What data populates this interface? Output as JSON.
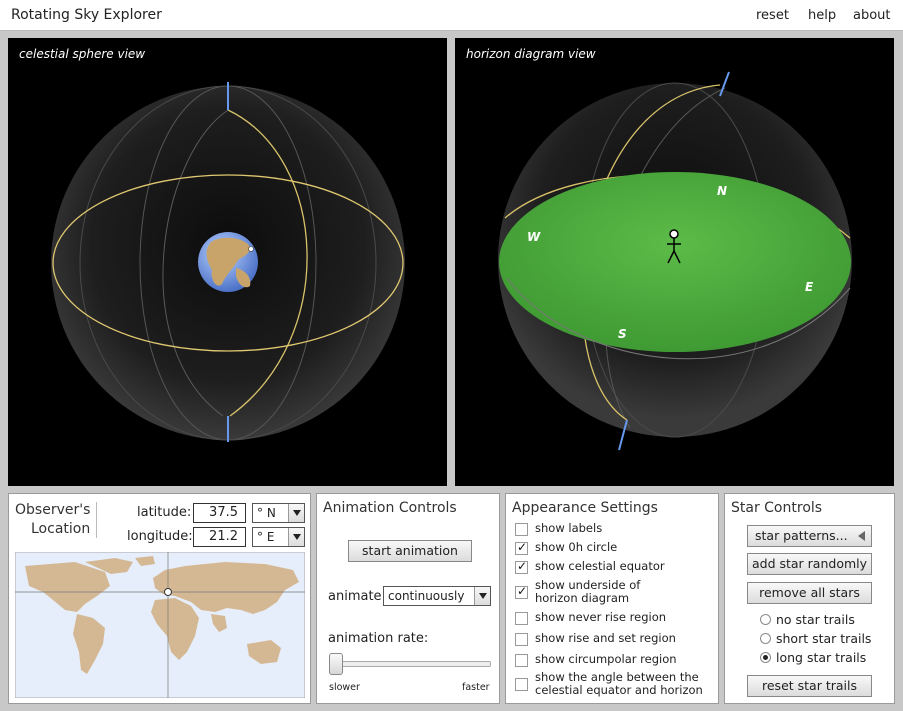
{
  "app": {
    "title": "Rotating Sky Explorer",
    "menu": {
      "reset": "reset",
      "help": "help",
      "about": "about"
    }
  },
  "views": {
    "celestial": {
      "label": "celestial sphere view"
    },
    "horizon": {
      "label": "horizon diagram view",
      "directions": {
        "north": "N",
        "east": "E",
        "south": "S",
        "west": "W"
      }
    }
  },
  "observer": {
    "title_line1": "Observer's",
    "title_line2": "Location",
    "latitude_label": "latitude:",
    "latitude_value": "37.5",
    "latitude_dir": "° N",
    "longitude_label": "longitude:",
    "longitude_value": "21.2",
    "longitude_dir": "° E"
  },
  "animation": {
    "title": "Animation Controls",
    "start_button": "start animation",
    "animate_label": "animate",
    "animate_value": "continuously",
    "rate_label": "animation rate:",
    "slower": "slower",
    "faster": "faster",
    "rate": 0.0
  },
  "appearance": {
    "title": "Appearance Settings",
    "options": [
      {
        "label": "show labels",
        "checked": false
      },
      {
        "label": "show 0h circle",
        "checked": true
      },
      {
        "label": "show celestial equator",
        "checked": true
      },
      {
        "label_line1": "show underside of",
        "label_line2": "horizon diagram",
        "checked": true
      },
      {
        "label": "show never rise region",
        "checked": false
      },
      {
        "label": "show rise and set region",
        "checked": false
      },
      {
        "label": "show circumpolar region",
        "checked": false
      },
      {
        "label_line1": "show the angle between the",
        "label_line2": "celestial equator and horizon",
        "checked": false
      }
    ]
  },
  "stars": {
    "title": "Star Controls",
    "patterns_button": "star patterns...",
    "add_button": "add star randomly",
    "remove_button": "remove all stars",
    "trails": [
      {
        "label": "no star trails",
        "selected": false
      },
      {
        "label": "short star trails",
        "selected": false
      },
      {
        "label": "long star trails",
        "selected": true
      }
    ],
    "reset_button": "reset star trails"
  },
  "colors": {
    "view_bg": "#000000",
    "horizon_plane": "#4caa3c",
    "celestial_equator": "#e8d27a",
    "pole_axis": "#6699ee",
    "map_ocean": "#e6eefb",
    "map_land": "#d4b894"
  }
}
